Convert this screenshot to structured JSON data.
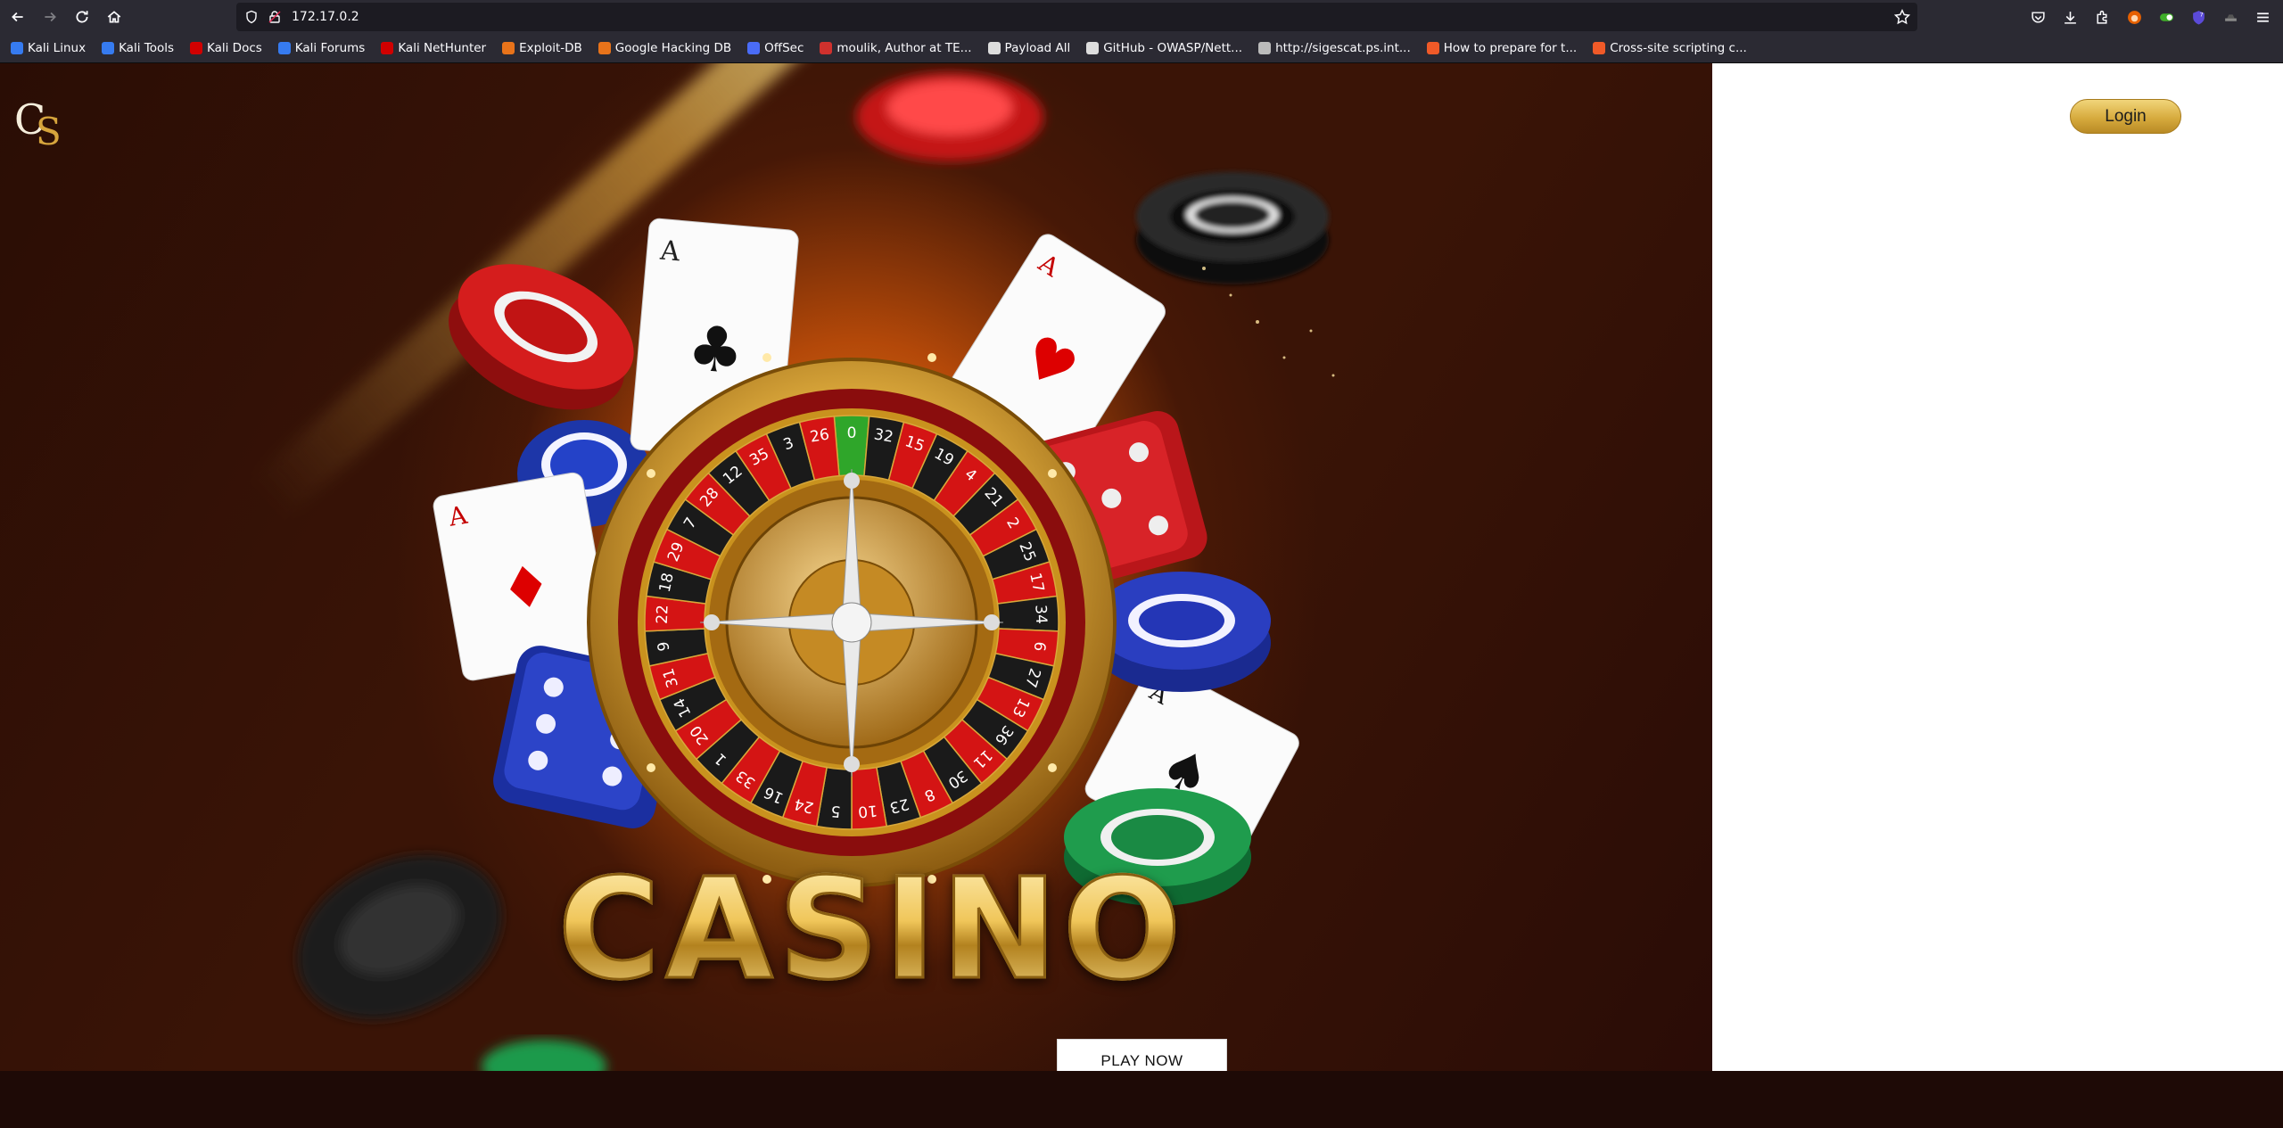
{
  "browser": {
    "url": "172.17.0.2",
    "bookmarks": [
      {
        "label": "Kali Linux",
        "color": "#367bf0"
      },
      {
        "label": "Kali Tools",
        "color": "#367bf0"
      },
      {
        "label": "Kali Docs",
        "color": "#d10000"
      },
      {
        "label": "Kali Forums",
        "color": "#367bf0"
      },
      {
        "label": "Kali NetHunter",
        "color": "#d10000"
      },
      {
        "label": "Exploit-DB",
        "color": "#e8731a"
      },
      {
        "label": "Google Hacking DB",
        "color": "#e8731a"
      },
      {
        "label": "OffSec",
        "color": "#4a6cf7"
      },
      {
        "label": "moulik, Author at TE...",
        "color": "#d0312d"
      },
      {
        "label": "Payload All",
        "color": "#dddddd"
      },
      {
        "label": "GitHub - OWASP/Nett...",
        "color": "#dddddd"
      },
      {
        "label": "http://sigescat.ps.int...",
        "color": "#bbbbbb"
      },
      {
        "label": "How to prepare for t...",
        "color": "#f05a28"
      },
      {
        "label": "Cross-site scripting c...",
        "color": "#f05a28"
      }
    ]
  },
  "page": {
    "logo_c": "C",
    "logo_s": "S",
    "login_label": "Login",
    "hero_title": "CASINO",
    "play_label": "PLAY NOW",
    "roulette_numbers": [
      "0",
      "32",
      "15",
      "19",
      "4",
      "21",
      "2",
      "25",
      "17",
      "34",
      "6",
      "27",
      "13",
      "36",
      "11",
      "30",
      "8",
      "23",
      "10",
      "5",
      "24",
      "16",
      "33",
      "1",
      "20",
      "14",
      "31",
      "9",
      "22",
      "18",
      "29",
      "7",
      "28",
      "12",
      "35",
      "3",
      "26"
    ]
  },
  "colors": {
    "gold": "#d7ab3e",
    "hero_dark": "#2a0d05",
    "right_panel": "#ffffff"
  }
}
